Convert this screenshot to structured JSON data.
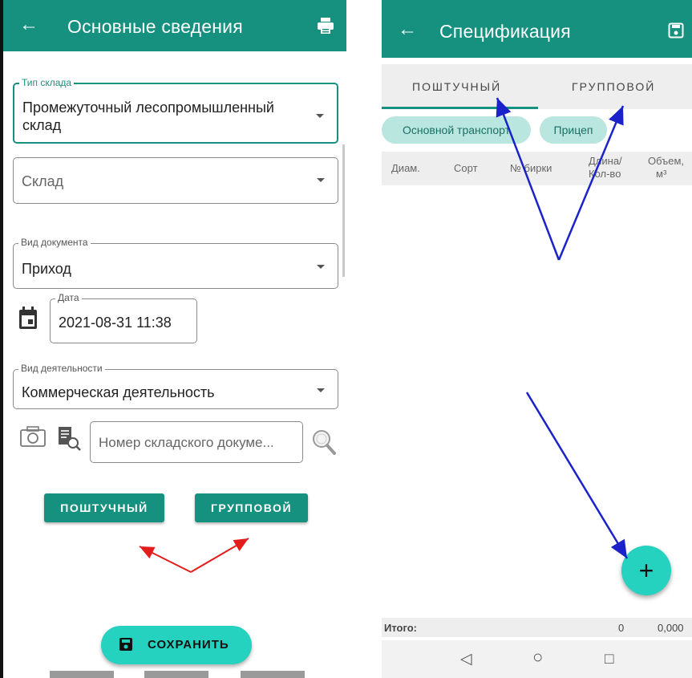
{
  "left_screen": {
    "title": "Основные сведения",
    "back_glyph": "←",
    "print_icon": "printer-icon",
    "warehouse_type": {
      "label": "Тип склада",
      "value_line1": "Промежуточный лесопромышленный",
      "value_line2": "склад"
    },
    "warehouse": {
      "placeholder": "Склад"
    },
    "document_type": {
      "label": "Вид документа",
      "value": "Приход"
    },
    "date": {
      "label": "Дата",
      "value": "2021-08-31 11:38"
    },
    "activity_type": {
      "label": "Вид деятельности",
      "value": "Коммерческая деятельность"
    },
    "doc_number": {
      "placeholder": "Номер складского докуме..."
    },
    "buttons": {
      "piece": "ПОШТУЧНЫЙ",
      "group": "ГРУППОВОЙ"
    },
    "save_label": "СОХРАНИТЬ",
    "colors": {
      "primary": "#16907f",
      "fab": "#25d2c0",
      "arrow": "#e51c1c"
    }
  },
  "right_screen": {
    "title": "Спецификация",
    "back_glyph": "←",
    "save_icon": "floppy-disk-icon",
    "tabs": [
      "ПОШТУЧНЫЙ",
      "ГРУППОВОЙ"
    ],
    "active_tab": "ПОШТУЧНЫЙ",
    "chips": [
      "Основной транспорт",
      "Прицеп"
    ],
    "columns": [
      {
        "line1": "Диам.",
        "line2": ""
      },
      {
        "line1": "Сорт",
        "line2": ""
      },
      {
        "line1": "№ бирки",
        "line2": ""
      },
      {
        "line1": "Длина/",
        "line2": "Кол-во"
      },
      {
        "line1": "Объем,",
        "line2": "м³"
      }
    ],
    "totals": {
      "label": "Итого:",
      "count": "0",
      "volume": "0,000"
    },
    "fab_glyph": "+",
    "nav": {
      "back": "◁",
      "home": "○",
      "recent": "□"
    },
    "colors": {
      "arrow": "#1b22c9"
    }
  }
}
